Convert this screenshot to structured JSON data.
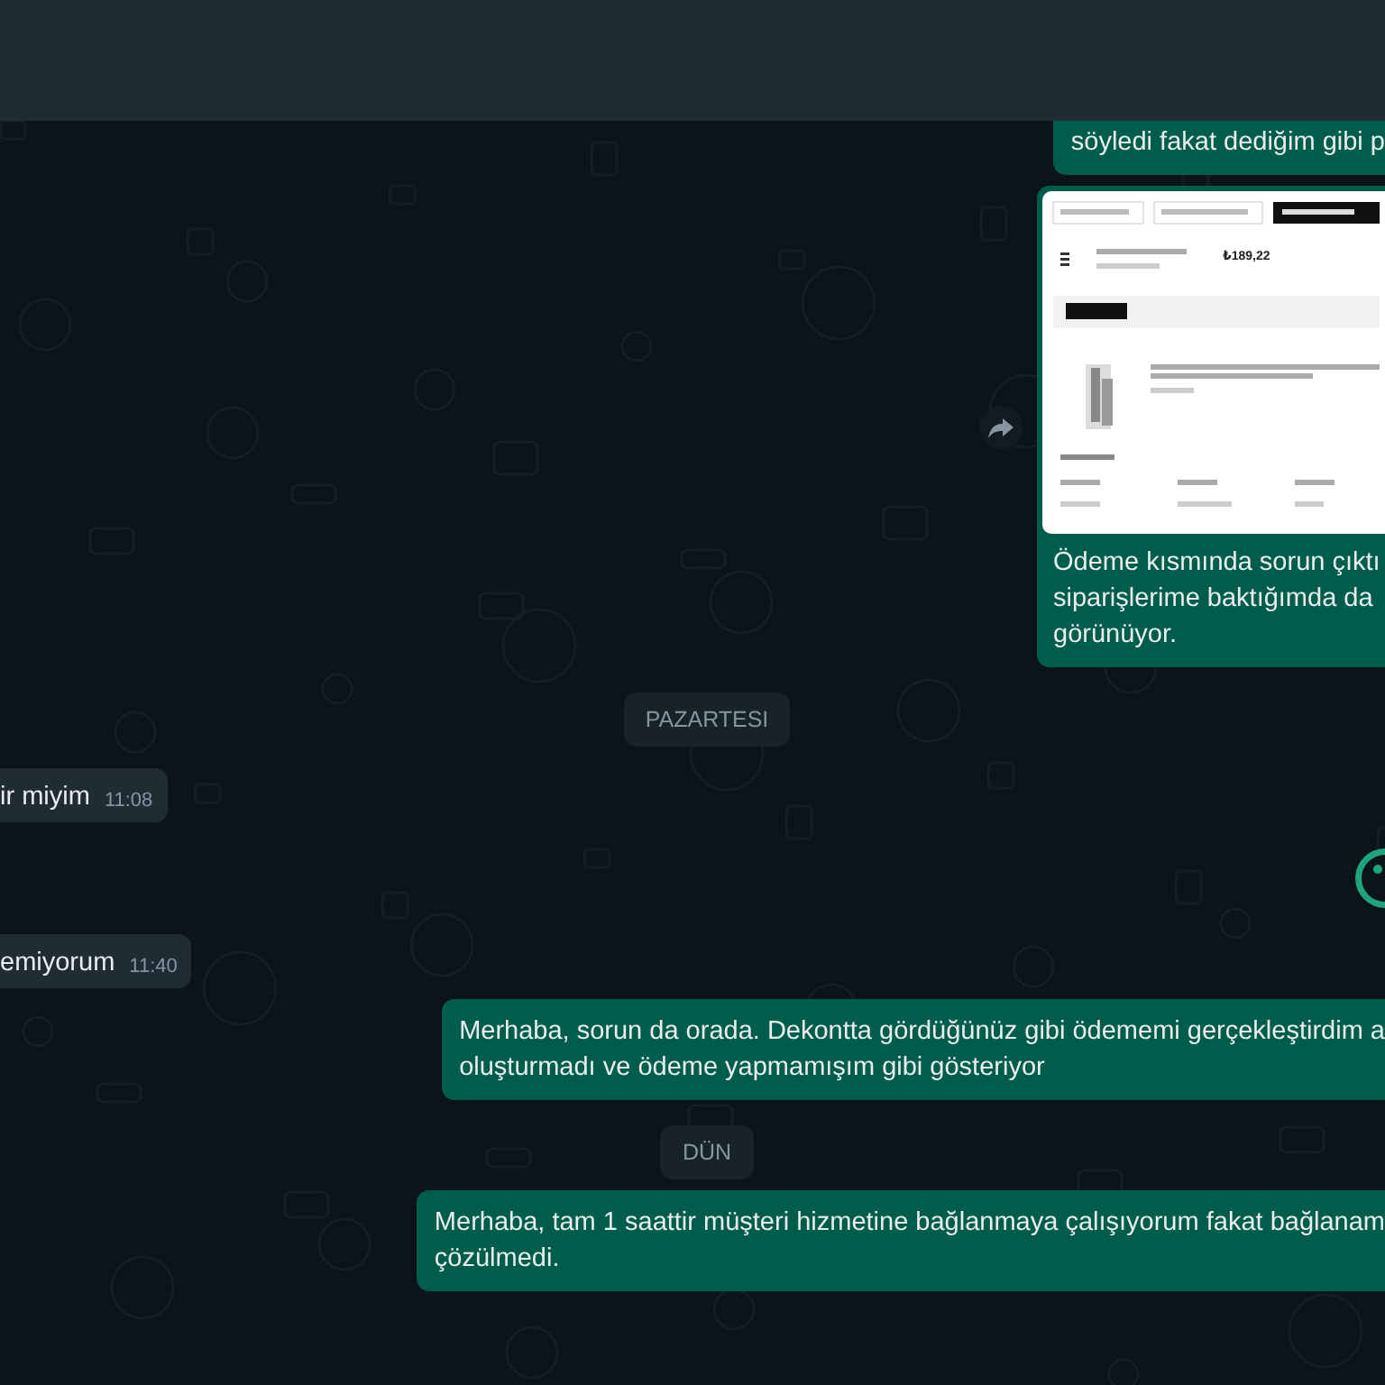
{
  "messages": [
    {
      "kind": "outgoing",
      "lines": [
        "söyledi fakat dediğim gibi p"
      ]
    },
    {
      "kind": "image",
      "price": "₺189,22",
      "lines": [
        "Ödeme kısmında sorun çıktı",
        "siparişlerime baktığımda da",
        "görünüyor."
      ]
    },
    {
      "kind": "date",
      "text": "PAZARTESI"
    },
    {
      "kind": "incoming",
      "lines": [
        "ir miyim"
      ],
      "time": "11:08"
    },
    {
      "kind": "sticker"
    },
    {
      "kind": "incoming",
      "lines": [
        "emiyorum"
      ],
      "time": "11:40"
    },
    {
      "kind": "outgoing",
      "lines": [
        "Merhaba, sorun da orada. Dekontta gördüğünüz gibi ödememi gerçekleştirdim a",
        "oluşturmadı ve ödeme yapmamışım gibi gösteriyor"
      ]
    },
    {
      "kind": "date",
      "text": "DÜN"
    },
    {
      "kind": "outgoing",
      "lines": [
        "Merhaba, tam 1 saattir müşteri hizmetine bağlanmaya çalışıyorum fakat bağlanam",
        "çözülmedi."
      ]
    }
  ]
}
